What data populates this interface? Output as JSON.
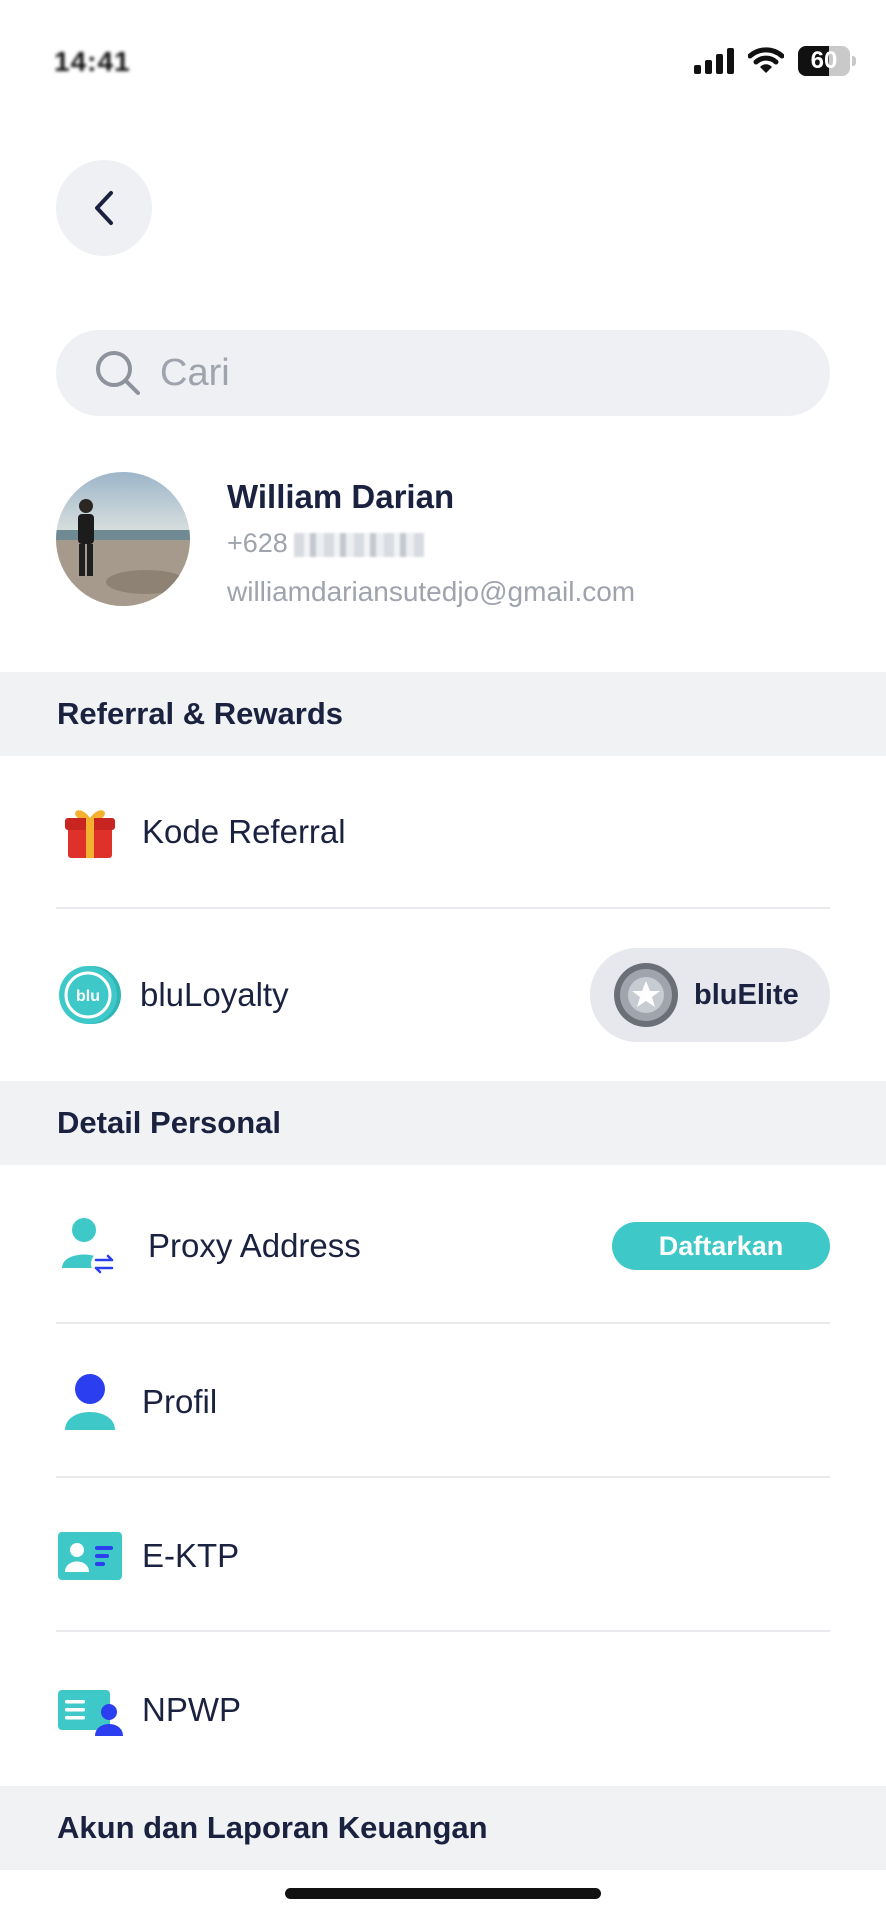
{
  "status_bar": {
    "time": "14:41",
    "battery": "60"
  },
  "search": {
    "placeholder": "Cari"
  },
  "profile": {
    "name": "William Darian",
    "phone_prefix": "+628",
    "email": "williamdariansutedjo@gmail.com"
  },
  "sections": {
    "referral": {
      "title": "Referral & Rewards",
      "items": [
        {
          "label": "Kode Referral",
          "icon": "gift-icon"
        },
        {
          "label": "bluLoyalty",
          "icon": "blu-coin-icon",
          "badge": "bluElite"
        }
      ]
    },
    "personal": {
      "title": "Detail Personal",
      "items": [
        {
          "label": "Proxy Address",
          "icon": "proxy-user-icon",
          "action": "Daftarkan"
        },
        {
          "label": "Profil",
          "icon": "user-icon"
        },
        {
          "label": "E-KTP",
          "icon": "id-card-icon"
        },
        {
          "label": "NPWP",
          "icon": "tax-card-icon"
        }
      ]
    },
    "finance": {
      "title": "Akun dan Laporan Keuangan"
    }
  },
  "colors": {
    "teal": "#3ec8c8",
    "navy": "#1a2240",
    "blue": "#2b3ff0",
    "gift_red": "#e0302a",
    "gift_gold": "#f3b12f"
  }
}
